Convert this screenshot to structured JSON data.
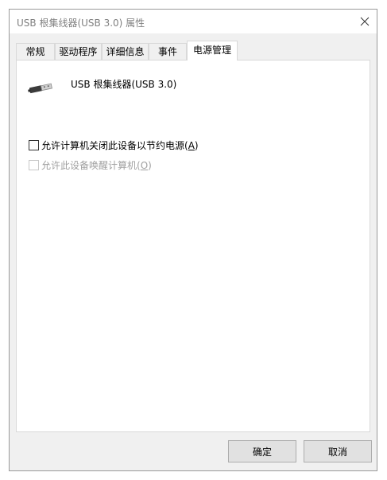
{
  "window": {
    "title": "USB 根集线器(USB 3.0) 属性",
    "close_icon": "close-icon"
  },
  "tabs": [
    {
      "label": "常规",
      "active": false
    },
    {
      "label": "驱动程序",
      "active": false
    },
    {
      "label": "详细信息",
      "active": false
    },
    {
      "label": "事件",
      "active": false
    },
    {
      "label": "电源管理",
      "active": true
    }
  ],
  "device": {
    "icon": "usb-plug-icon",
    "name": "USB 根集线器(USB 3.0)"
  },
  "options": [
    {
      "label": "允许计算机关闭此设备以节约电源(",
      "accel": "A",
      "suffix": ")",
      "checked": false,
      "enabled": true
    },
    {
      "label": "允许此设备唤醒计算机(",
      "accel": "O",
      "suffix": ")",
      "checked": false,
      "enabled": false
    }
  ],
  "buttons": {
    "ok": "确定",
    "cancel": "取消"
  }
}
